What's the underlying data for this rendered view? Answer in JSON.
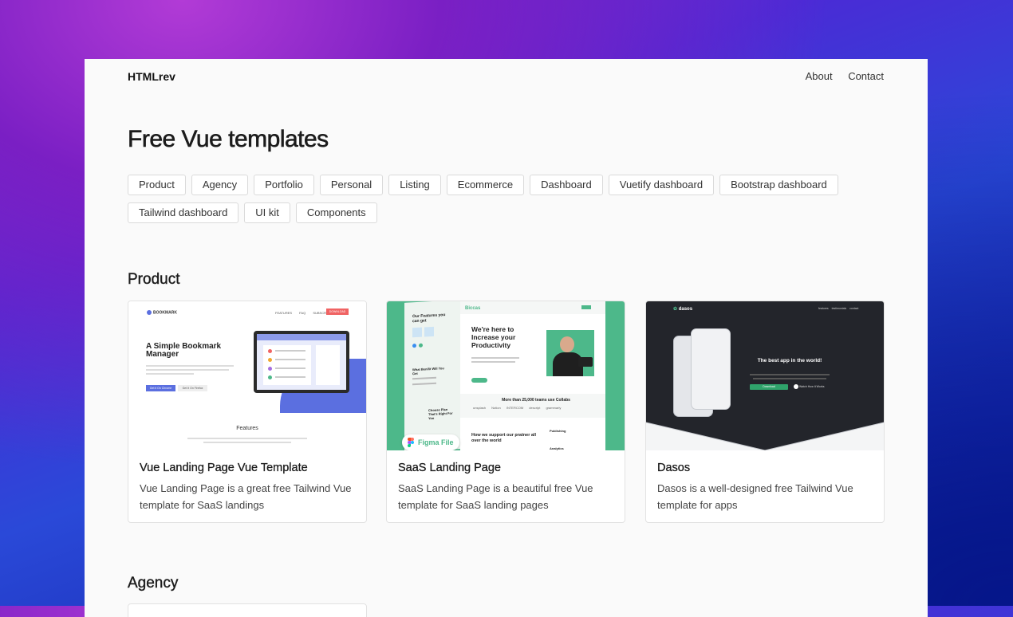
{
  "nav": {
    "brand": "HTMLrev",
    "links": [
      "About",
      "Contact"
    ]
  },
  "page_title": "Free Vue templates",
  "tags": [
    "Product",
    "Agency",
    "Portfolio",
    "Personal",
    "Listing",
    "Ecommerce",
    "Dashboard",
    "Vuetify dashboard",
    "Bootstrap dashboard",
    "Tailwind dashboard",
    "UI kit",
    "Components"
  ],
  "sections": [
    {
      "title": "Product"
    },
    {
      "title": "Agency"
    }
  ],
  "cards": [
    {
      "title": "Vue Landing Page Vue Template",
      "desc": "Vue Landing Page is a great free Tailwind Vue template for SaaS landings",
      "thumb": {
        "brand": "BOOKMARK",
        "menu": [
          "FEATURES",
          "FAQ",
          "SUBSCRIBE"
        ],
        "cta": "DOWNLOAD",
        "heading": "A Simple Bookmark Manager",
        "btn1": "Get it On Chrome",
        "btn2": "Get It On Firefox",
        "features": "Features"
      }
    },
    {
      "title": "SaaS Landing Page",
      "desc": "SaaS Landing Page is a beautiful free Vue template for SaaS landing pages",
      "thumb": {
        "brand": "Biccas",
        "heading": "We're here to Increase your Productivity",
        "side_heading": "Our Features you can get",
        "teams": "More than 25,000 teams use Collabs",
        "support": "How we support our pratner all over the world",
        "badge": "Figma File",
        "side2": "What Benifit Will You Get",
        "side3": "Choose Plan That's Right For You",
        "publishing": "Publishing",
        "analytics": "Analytics",
        "logos": [
          "unsplash",
          "Notion",
          "INTERCOM",
          "descript",
          "grammarly"
        ]
      }
    },
    {
      "title": "Dasos",
      "desc": "Dasos is a well-designed free Tailwind Vue template for apps",
      "thumb": {
        "brand": "dasos",
        "menu": [
          "features",
          "testimonials",
          "contact"
        ],
        "heading": "The best app in the world!",
        "btn": "Download",
        "watch": "Watch How It Works"
      }
    }
  ],
  "colors": {
    "accent_blue": "#5b6fe0",
    "green": "#4db88a",
    "dark": "#23252b",
    "red": "#f06363"
  }
}
